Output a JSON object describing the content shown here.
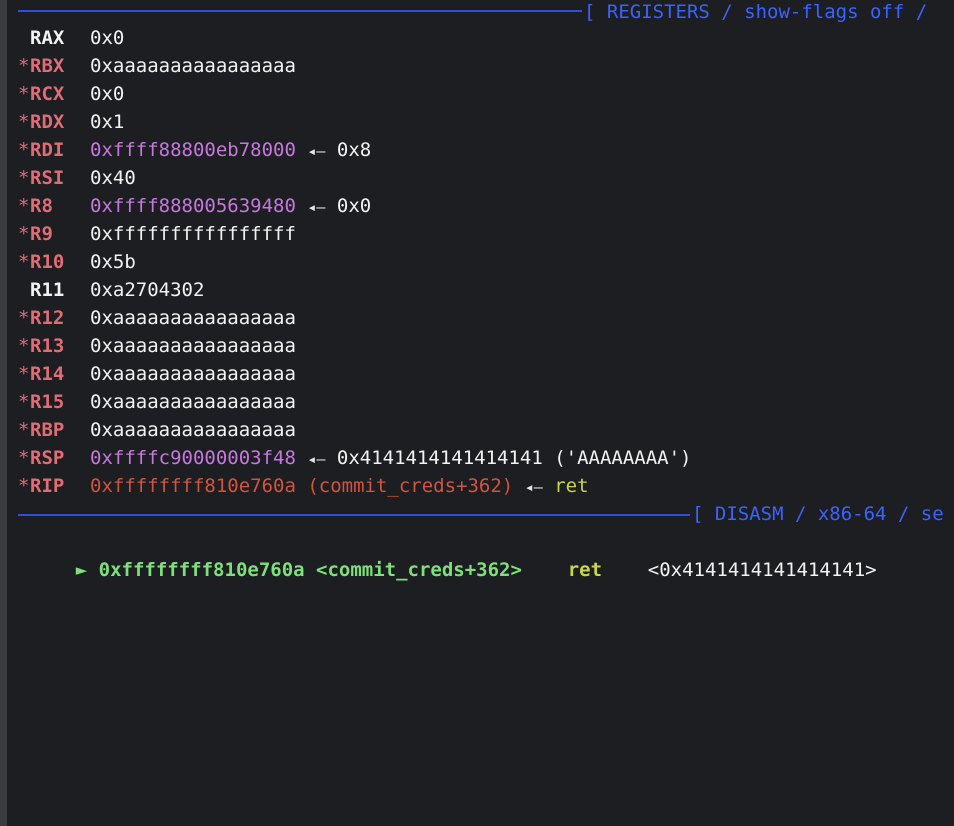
{
  "registers_header": {
    "label": "[ REGISTERS / show-flags off / "
  },
  "registers": [
    {
      "changed": false,
      "name": "RAX",
      "value": "0x0",
      "value_color": "white"
    },
    {
      "changed": true,
      "name": "RBX",
      "value": "0xaaaaaaaaaaaaaaaa",
      "value_color": "white"
    },
    {
      "changed": true,
      "name": "RCX",
      "value": "0x0",
      "value_color": "white"
    },
    {
      "changed": true,
      "name": "RDX",
      "value": "0x1",
      "value_color": "white"
    },
    {
      "changed": true,
      "name": "RDI",
      "value": "0xffff88800eb78000",
      "value_color": "purple",
      "deref_arrow": "◂—",
      "deref": "0x8"
    },
    {
      "changed": true,
      "name": "RSI",
      "value": "0x40",
      "value_color": "white"
    },
    {
      "changed": true,
      "name": "R8",
      "value": "0xffff888005639480",
      "value_color": "purple",
      "deref_arrow": "◂—",
      "deref": "0x0"
    },
    {
      "changed": true,
      "name": "R9",
      "value": "0xffffffffffffffff",
      "value_color": "white"
    },
    {
      "changed": true,
      "name": "R10",
      "value": "0x5b",
      "value_color": "white"
    },
    {
      "changed": false,
      "name": "R11",
      "value": "0xa2704302",
      "value_color": "white"
    },
    {
      "changed": true,
      "name": "R12",
      "value": "0xaaaaaaaaaaaaaaaa",
      "value_color": "white"
    },
    {
      "changed": true,
      "name": "R13",
      "value": "0xaaaaaaaaaaaaaaaa",
      "value_color": "white"
    },
    {
      "changed": true,
      "name": "R14",
      "value": "0xaaaaaaaaaaaaaaaa",
      "value_color": "white"
    },
    {
      "changed": true,
      "name": "R15",
      "value": "0xaaaaaaaaaaaaaaaa",
      "value_color": "white"
    },
    {
      "changed": true,
      "name": "RBP",
      "value": "0xaaaaaaaaaaaaaaaa",
      "value_color": "white"
    },
    {
      "changed": true,
      "name": "RSP",
      "value": "0xffffc90000003f48",
      "value_color": "purple",
      "deref_arrow": "◂—",
      "deref": "0x4141414141414141 ('AAAAAAAA')"
    },
    {
      "changed": true,
      "name": "RIP",
      "value": "0xffffffff810e760a (commit_creds+362)",
      "value_color": "orange-red",
      "deref_arrow": "◂—",
      "deref": "ret",
      "deref_color": "yellow"
    }
  ],
  "changed_marker": "*",
  "disasm_header": {
    "label": "[ DISASM / x86-64 / se"
  },
  "disasm": {
    "marker": "►",
    "address": "0xffffffff810e760a",
    "symbol": "<commit_creds+362>",
    "mnemonic": "ret",
    "operand": "<0x4141414141414141>"
  },
  "colors": {
    "background": "#1c1e22",
    "separator": "#2f4fd8",
    "register_changed": "#e06c75",
    "pointer_heap": "#c678dd",
    "pointer_code": "#d2543f",
    "current_instruction": "#7ee07a",
    "mnemonic": "#c8d64a"
  }
}
